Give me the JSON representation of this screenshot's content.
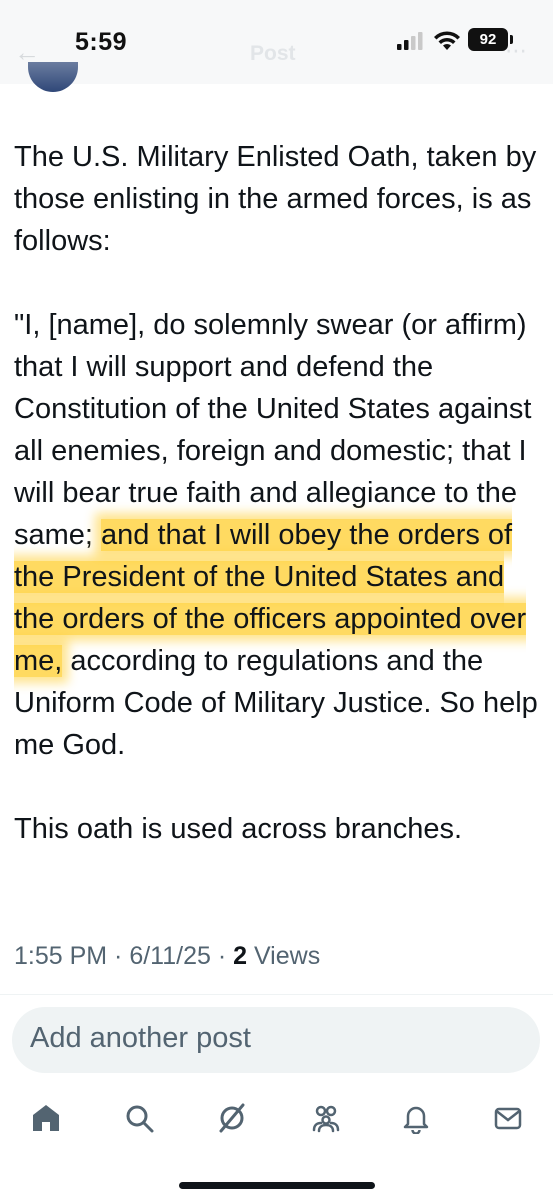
{
  "status_bar": {
    "time": "5:59",
    "battery": "92"
  },
  "header": {
    "title": "Post"
  },
  "post": {
    "paragraph_1": "The U.S. Military Enlisted Oath, taken by those enlisting in the armed forces, is as follows:",
    "oath_part_1": "\"I, [name], do solemnly swear (or affirm) that I will support and defend the Constitution of the United States against all enemies, foreign and domestic; that I will bear true faith and allegiance to the same; ",
    "oath_highlighted": "and that I will obey the orders of the President of the United States and the orders of the officers appointed over me,",
    "oath_part_2": " according to regulations and the Uniform Code of Military Justice. So help me God.",
    "paragraph_3": "This oath is used across branches.",
    "highlight_color": "#ffc400"
  },
  "meta": {
    "time": "1:55 PM",
    "sep_1": " · ",
    "date": "6/11/25",
    "sep_2": " · ",
    "views_count": "2",
    "views_label": " Views"
  },
  "reply": {
    "placeholder": "Add another post"
  },
  "nav": {
    "items": [
      "home-icon",
      "search-icon",
      "grok-icon",
      "communities-icon",
      "notifications-icon",
      "messages-icon"
    ]
  }
}
